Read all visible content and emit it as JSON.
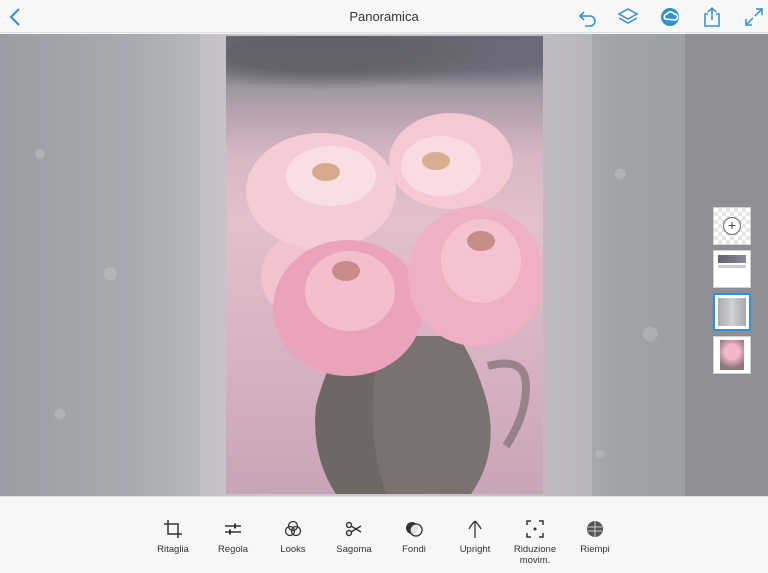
{
  "header": {
    "title": "Panoramica",
    "icons": {
      "back": "chevron-left-icon",
      "undo": "undo-icon",
      "layers": "layers-icon",
      "cloud": "creative-cloud-icon",
      "share": "share-icon",
      "fullscreen": "fullscreen-icon"
    }
  },
  "colors": {
    "accent": "#2f8fd8",
    "canvas_bg": "#8e9196"
  },
  "layers_panel": {
    "items": [
      {
        "type": "add-layer",
        "icon": "plus-icon"
      },
      {
        "type": "sky-layer"
      },
      {
        "type": "gray-texture-layer",
        "selected": true
      },
      {
        "type": "flower-photo-layer"
      }
    ]
  },
  "toolbar": {
    "tools": [
      {
        "label": "Ritaglia",
        "icon": "crop-icon"
      },
      {
        "label": "Regola",
        "icon": "sliders-icon"
      },
      {
        "label": "Looks",
        "icon": "looks-icon"
      },
      {
        "label": "Sagoma",
        "icon": "scissors-icon"
      },
      {
        "label": "Fondi",
        "icon": "blend-icon"
      },
      {
        "label": "Upright",
        "icon": "upright-icon"
      },
      {
        "label": "Riduzione",
        "label2": "movim.",
        "icon": "shake-reduction-icon"
      },
      {
        "label": "Riempi",
        "icon": "fill-icon"
      }
    ]
  }
}
